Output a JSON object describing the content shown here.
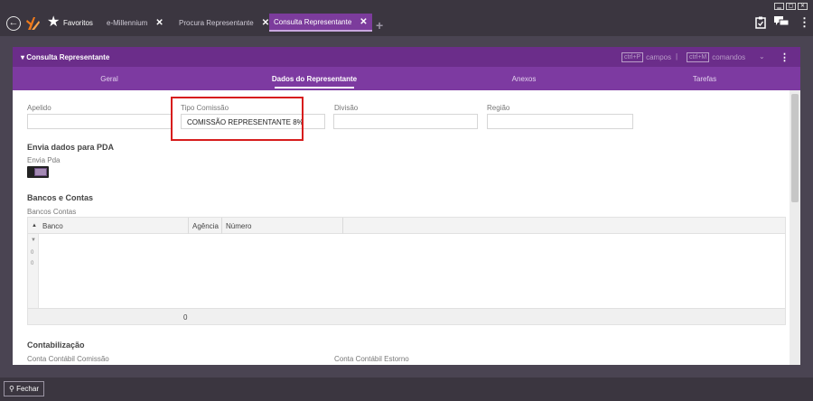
{
  "window_controls": {
    "minimize": "▁",
    "maximize": "▢",
    "close": "✕"
  },
  "topbar": {
    "favorites_label": "Favoritos",
    "tabs": [
      {
        "label": "e-Millennium",
        "close": "✕"
      },
      {
        "label": "Procura Representante",
        "close": "✕"
      },
      {
        "label": "Consulta Representante",
        "close": "✕"
      }
    ],
    "add_tab": "+",
    "icons": [
      "back-icon",
      "logo",
      "star-icon",
      "clipboard-icon",
      "chat-icon",
      "menu-icon"
    ]
  },
  "panel": {
    "title": "Consulta Representante",
    "shortcut_fields_key": "ctrl+P",
    "shortcut_fields_label": "campos",
    "shortcut_separator": "|",
    "shortcut_commands_key": "ctrl+M",
    "shortcut_commands_label": "comandos",
    "tabs": [
      "Geral",
      "Dados do Representante",
      "Anexos",
      "Tarefas"
    ],
    "active_tab": "Dados do Representante"
  },
  "form": {
    "apelido_label": "Apelido",
    "apelido_value": "",
    "tipo_comissao_label": "Tipo Comissão",
    "tipo_comissao_value": "COMISSÃO REPRESENTANTE 8%",
    "divisao_label": "Divisão",
    "divisao_value": "",
    "regiao_label": "Região",
    "regiao_value": ""
  },
  "pda": {
    "section_title": "Envia dados para PDA",
    "envia_pda_label": "Envia Pda"
  },
  "bancos": {
    "section_title": "Bancos e Contas",
    "subtitle": "Bancos Contas",
    "columns": [
      "Banco",
      "Agência",
      "Número"
    ],
    "row_markers": [
      "0",
      "0"
    ],
    "footer_count": "0"
  },
  "contabilizacao": {
    "section_title": "Contabilização",
    "conta_comissao_label": "Conta Contábil Comissão",
    "conta_estorno_label": "Conta Contábil Estorno"
  },
  "bottombar": {
    "close_label": "Fechar"
  },
  "colors": {
    "accent": "#7d3aa1",
    "header": "#6b2d8a",
    "highlight": "#d71d1d",
    "chrome": "#3b3640"
  }
}
